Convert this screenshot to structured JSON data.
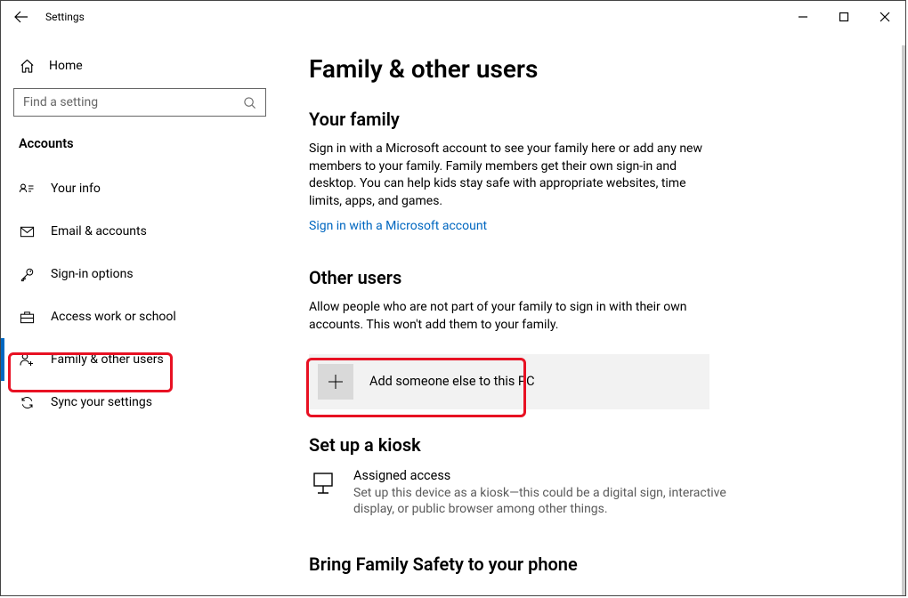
{
  "window": {
    "title": "Settings"
  },
  "sidebar": {
    "home_label": "Home",
    "search_placeholder": "Find a setting",
    "category": "Accounts",
    "items": [
      {
        "label": "Your info"
      },
      {
        "label": "Email & accounts"
      },
      {
        "label": "Sign-in options"
      },
      {
        "label": "Access work or school"
      },
      {
        "label": "Family & other users"
      },
      {
        "label": "Sync your settings"
      }
    ]
  },
  "main": {
    "page_title": "Family & other users",
    "family_head": "Your family",
    "family_body": "Sign in with a Microsoft account to see your family here or add any new members to your family. Family members get their own sign-in and desktop. You can help kids stay safe with appropriate websites, time limits, apps, and games.",
    "family_link": "Sign in with a Microsoft account",
    "other_head": "Other users",
    "other_body": "Allow people who are not part of your family to sign in with their own accounts. This won't add them to your family.",
    "add_user_label": "Add someone else to this PC",
    "kiosk_head": "Set up a kiosk",
    "kiosk_title": "Assigned access",
    "kiosk_sub": "Set up this device as a kiosk—this could be a digital sign, interactive display, or public browser among other things.",
    "bring_head": "Bring Family Safety to your phone"
  }
}
